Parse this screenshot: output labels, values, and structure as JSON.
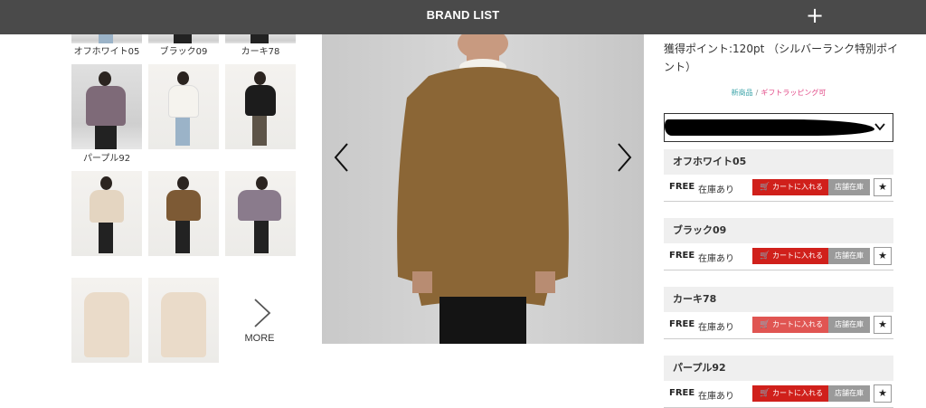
{
  "header": {
    "title": "BRAND LIST",
    "menu_icon": "plus-icon"
  },
  "thumbnails": {
    "top_captions": [
      "オフホワイト05",
      "ブラック09",
      "カーキ78"
    ],
    "purple_caption": "パープル92",
    "more_label": "MORE"
  },
  "product": {
    "points_text": "獲得ポイント:120pt （シルバーランク特別ポイント）",
    "tag_new": "新商品",
    "tag_separator": "/",
    "tag_gift": "ギフトラッピング可"
  },
  "colors": [
    {
      "name": "オフホワイト05",
      "size": "FREE",
      "stock": "在庫あり",
      "cart": "カートに入れる",
      "store": "店舗在庫"
    },
    {
      "name": "ブラック09",
      "size": "FREE",
      "stock": "在庫あり",
      "cart": "カートに入れる",
      "store": "店舗在庫"
    },
    {
      "name": "カーキ78",
      "size": "FREE",
      "stock": "在庫あり",
      "cart": "カートに入れる",
      "store": "店舗在庫"
    },
    {
      "name": "パープル92",
      "size": "FREE",
      "stock": "在庫あり",
      "cart": "カートに入れる",
      "store": "店舗在庫"
    }
  ],
  "accent_colors": {
    "cart_red": "#d0201b",
    "store_gray": "#9a9a9a",
    "header_bg": "#4a4a4a",
    "tag_teal": "#3aa3a8",
    "tag_pink": "#e24a87"
  }
}
